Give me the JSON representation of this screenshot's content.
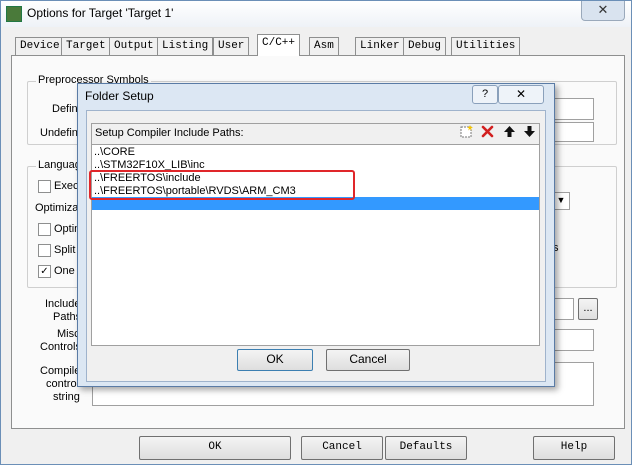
{
  "window": {
    "title": "Options for Target 'Target 1'",
    "close_glyph": "✕"
  },
  "tabs": [
    "Device",
    "Target",
    "Output",
    "Listing",
    "User",
    "C/C++",
    "Asm",
    "Linker",
    "Debug",
    "Utilities"
  ],
  "active_tab": "C/C++",
  "preprocessor": {
    "group_label": "Preprocessor Symbols",
    "define_label": "Defin",
    "undefine_label": "Undefin"
  },
  "language": {
    "group_label": "Languag",
    "execute_only": "Exec",
    "optimization_label": "Optimizatio",
    "optimize": "Optin",
    "split": "Split",
    "one": "One",
    "one_checked": "✓",
    "right_fragment": "s"
  },
  "include": {
    "include_label_1": "Include",
    "include_label_2": "Paths",
    "misc_label_1": "Misc",
    "misc_label_2": "Controls",
    "compiler_label_1": "Compiler",
    "compiler_label_2": "control",
    "compiler_label_3": "string",
    "browse_label": "..."
  },
  "bottom_buttons": {
    "ok": "OK",
    "cancel": "Cancel",
    "defaults": "Defaults",
    "help": "Help"
  },
  "dialog": {
    "title": "Folder Setup",
    "help_glyph": "?",
    "close_glyph": "✕",
    "header_label": "Setup Compiler Include Paths:",
    "toolbar": {
      "new": "New",
      "delete": "Delete",
      "move_up": "Move Up",
      "move_down": "Move Down"
    },
    "paths": [
      "..\\CORE",
      "..\\STM32F10X_LIB\\inc",
      "..\\FREERTOS\\include",
      "..\\FREERTOS\\portable\\RVDS\\ARM_CM3"
    ],
    "ok": "OK",
    "cancel": "Cancel",
    "colors": {
      "selection": "#3399ff",
      "highlight_box": "#e0262a"
    }
  }
}
